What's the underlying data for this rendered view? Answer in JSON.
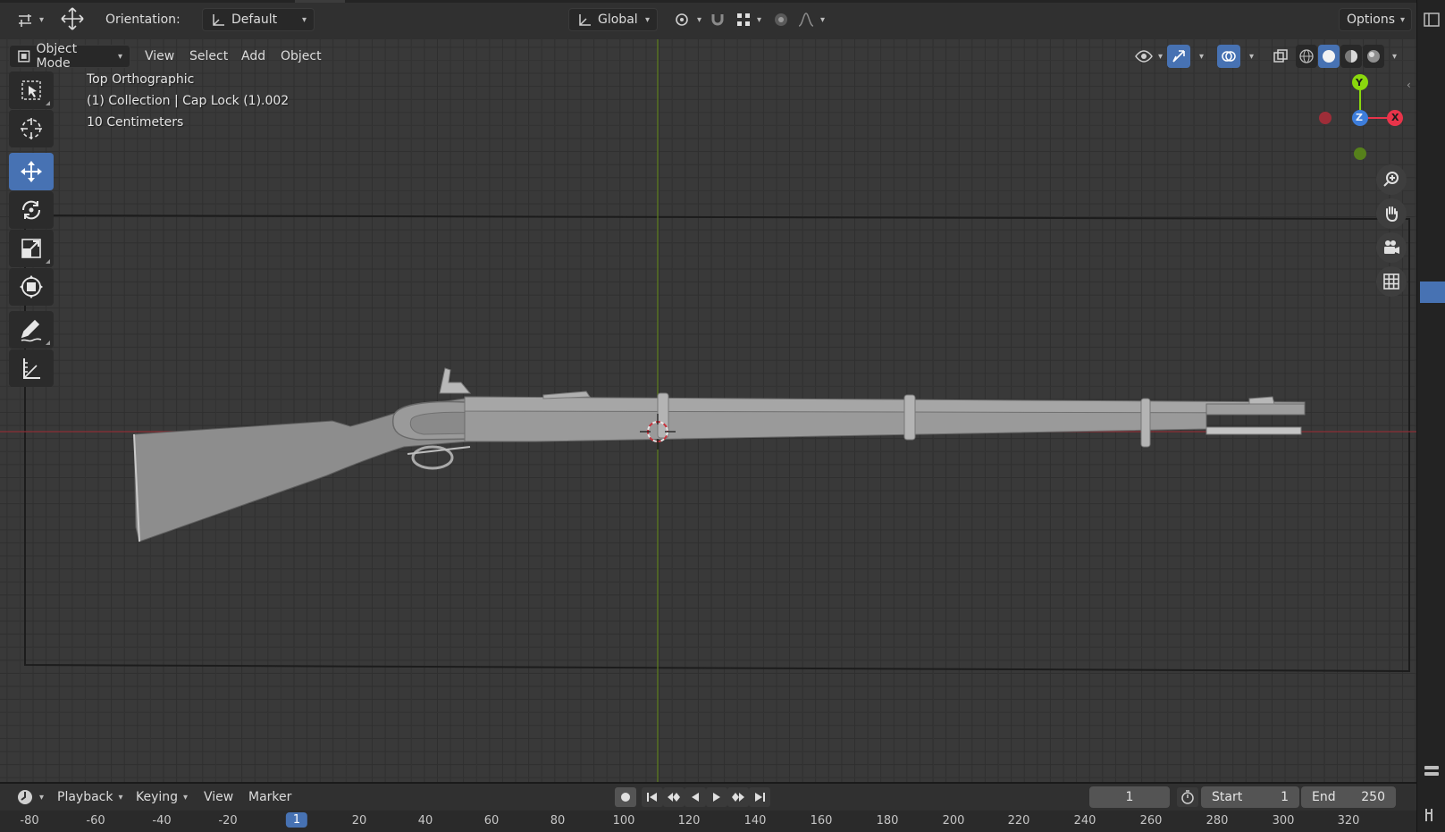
{
  "header": {
    "transform_icon": "move-gizmo-icon",
    "orientation_label": "Orientation:",
    "orientation_value": "Default",
    "pivot_value": "Global",
    "options_label": "Options"
  },
  "viewport_header": {
    "mode": "Object Mode",
    "menus": [
      "View",
      "Select",
      "Add",
      "Object"
    ]
  },
  "viewport": {
    "view_name": "Top Orthographic",
    "collection_info": "(1) Collection | Cap Lock (1).002",
    "scale_info": "10 Centimeters",
    "gizmo": {
      "y": "Y",
      "z": "Z",
      "x": "X"
    },
    "colors": {
      "x_axis": "#e8344a",
      "y_axis": "#8ad80d",
      "z_axis": "#3d7ddb",
      "active_tool": "#4772b3"
    }
  },
  "toolbar": {
    "tools": [
      "select-box",
      "cursor",
      "move",
      "rotate",
      "scale",
      "transform",
      "annotate",
      "measure"
    ],
    "active": "move"
  },
  "timeline": {
    "menus": [
      "Playback",
      "Keying",
      "View",
      "Marker"
    ],
    "current_frame": "1",
    "start_label": "Start",
    "start_value": "1",
    "end_label": "End",
    "end_value": "250",
    "ruler_ticks": [
      "-80",
      "-60",
      "-40",
      "-20",
      "1",
      "20",
      "40",
      "60",
      "80",
      "100",
      "120",
      "140",
      "160",
      "180",
      "200",
      "220",
      "240",
      "260",
      "280",
      "300",
      "320"
    ]
  }
}
